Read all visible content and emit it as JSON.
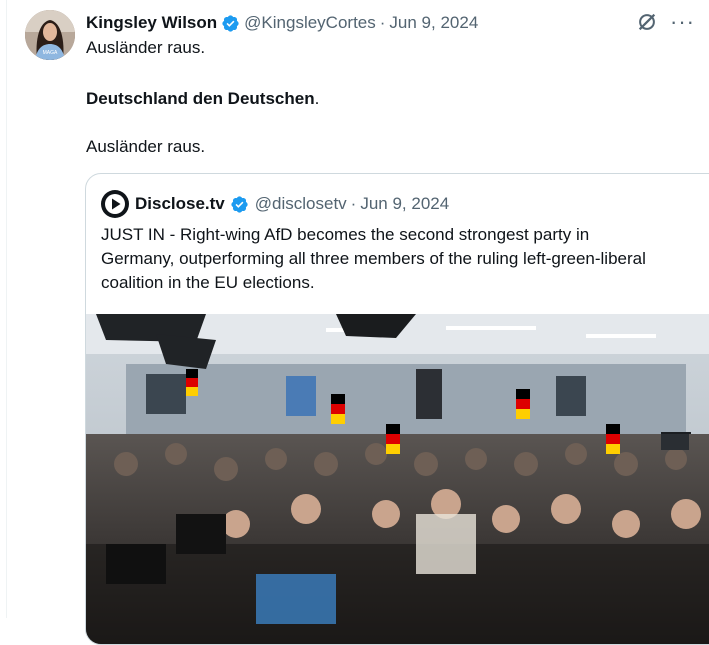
{
  "tweet": {
    "author_name": "Kingsley Wilson",
    "handle": "@KingsleyCortes",
    "separator": "·",
    "date": "Jun 9, 2024",
    "lines": [
      "Ausländer raus.",
      "Deutschland den Deutschen",
      ".",
      "Ausländer raus."
    ]
  },
  "quote": {
    "author_name": "Disclose.tv",
    "handle": "@disclosetv",
    "separator": "·",
    "date": "Jun 9, 2024",
    "text": "JUST IN - Right-wing AfD becomes the second strongest party in Germany, outperforming all three members of the ruling left-green-liberal coalition in the EU elections."
  },
  "icons": {
    "verified": "verified-badge-icon",
    "grok": "grok-icon",
    "more": "more-options-icon",
    "disclose_logo": "disclose-logo-icon"
  },
  "colors": {
    "verified_blue": "#1d9bf0",
    "secondary_text": "#536471",
    "border": "#cfd9de"
  }
}
